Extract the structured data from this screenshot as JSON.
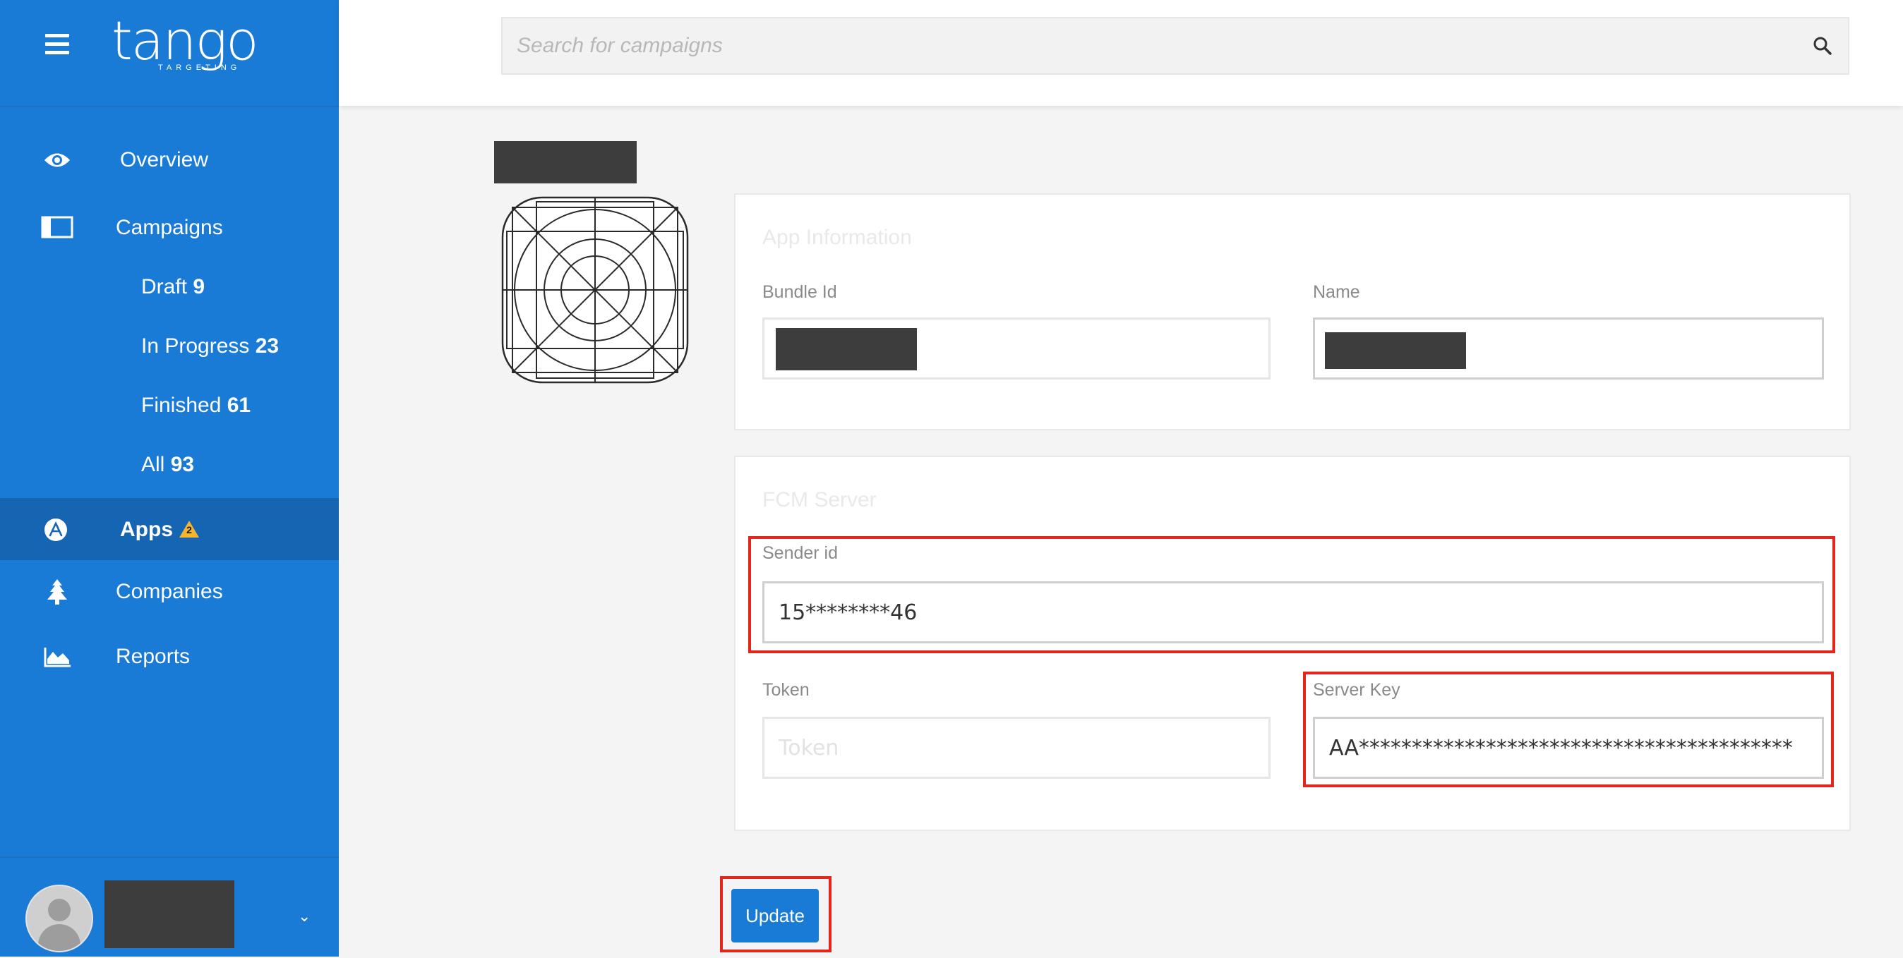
{
  "brand": {
    "name": "tango",
    "tagline": "TARGETING"
  },
  "sidebar": {
    "items": [
      {
        "label": "Overview"
      },
      {
        "label": "Campaigns"
      },
      {
        "label": "Apps",
        "badge": "2"
      },
      {
        "label": "Companies"
      },
      {
        "label": "Reports"
      }
    ],
    "campaign_filters": [
      {
        "label": "Draft",
        "count": "9"
      },
      {
        "label": "In Progress",
        "count": "23"
      },
      {
        "label": "Finished",
        "count": "61"
      },
      {
        "label": "All",
        "count": "93"
      }
    ]
  },
  "search": {
    "placeholder": "Search for campaigns"
  },
  "app_info": {
    "title": "App Information",
    "bundle_id_label": "Bundle Id",
    "name_label": "Name"
  },
  "fcm": {
    "title": "FCM Server",
    "sender_id_label": "Sender id",
    "sender_id_value": "15********46",
    "token_label": "Token",
    "token_placeholder": "Token",
    "server_key_label": "Server Key",
    "server_key_value": "AA*****************************************"
  },
  "actions": {
    "update_label": "Update"
  },
  "colors": {
    "sidebar": "#1a7bd6",
    "sidebar_active": "#1665b3",
    "highlight": "#e4251c",
    "warning": "#f5b52e"
  }
}
